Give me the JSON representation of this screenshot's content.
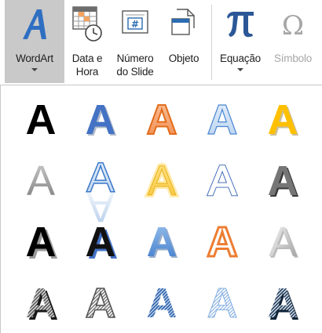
{
  "ribbon": {
    "buttons": [
      {
        "id": "wordart",
        "line1": "WordArt",
        "line2": "",
        "icon": "wordart-a-icon",
        "has_dropdown": true,
        "selected": true
      },
      {
        "id": "datahora",
        "line1": "Data e",
        "line2": "Hora",
        "icon": "calendar-clock-icon",
        "has_dropdown": false
      },
      {
        "id": "numero",
        "line1": "Número",
        "line2": "do Slide",
        "icon": "slide-number-icon",
        "has_dropdown": false
      },
      {
        "id": "objeto",
        "line1": "Objeto",
        "line2": "",
        "icon": "object-icon",
        "has_dropdown": false
      },
      {
        "id": "equacao",
        "line1": "Equação",
        "line2": "",
        "icon": "pi-icon",
        "has_dropdown": true
      },
      {
        "id": "simbolo",
        "line1": "Símbolo",
        "line2": "",
        "icon": "omega-icon",
        "has_dropdown": false,
        "disabled": true
      }
    ]
  },
  "gallery": {
    "letter": "A",
    "rows": [
      [
        {
          "name": "style-black-fill"
        },
        {
          "name": "style-blue-fill-shadow"
        },
        {
          "name": "style-orange-gradient-outline"
        },
        {
          "name": "style-blue-outline-light"
        },
        {
          "name": "style-gold-fill-shadow"
        }
      ],
      [
        {
          "name": "style-gray-gradient"
        },
        {
          "name": "style-blue-reflection"
        },
        {
          "name": "style-gold-glow"
        },
        {
          "name": "style-blue-double-outline"
        },
        {
          "name": "style-dark-gray-3d"
        }
      ],
      [
        {
          "name": "style-black-heavy-shadow"
        },
        {
          "name": "style-black-blue-shadow"
        },
        {
          "name": "style-blue-bevel"
        },
        {
          "name": "style-orange-outline"
        },
        {
          "name": "style-silver-bevel"
        }
      ],
      [
        {
          "name": "style-dark-gray-pattern"
        },
        {
          "name": "style-gray-stripe-pattern"
        },
        {
          "name": "style-blue-stripe-pattern"
        },
        {
          "name": "style-light-blue-stripe-pattern"
        },
        {
          "name": "style-navy-stripe-pattern"
        }
      ]
    ]
  },
  "colors": {
    "selected_bg": "#c9c9c9",
    "wordart_icon": "#2f6fc2",
    "pi_icon": "#2b5797",
    "disabled": "#a6a6a6",
    "black": "#000000",
    "blue": "#4472c4",
    "orange": "#ed7d31",
    "gold": "#ffc000",
    "gray": "#7f7f7f"
  }
}
